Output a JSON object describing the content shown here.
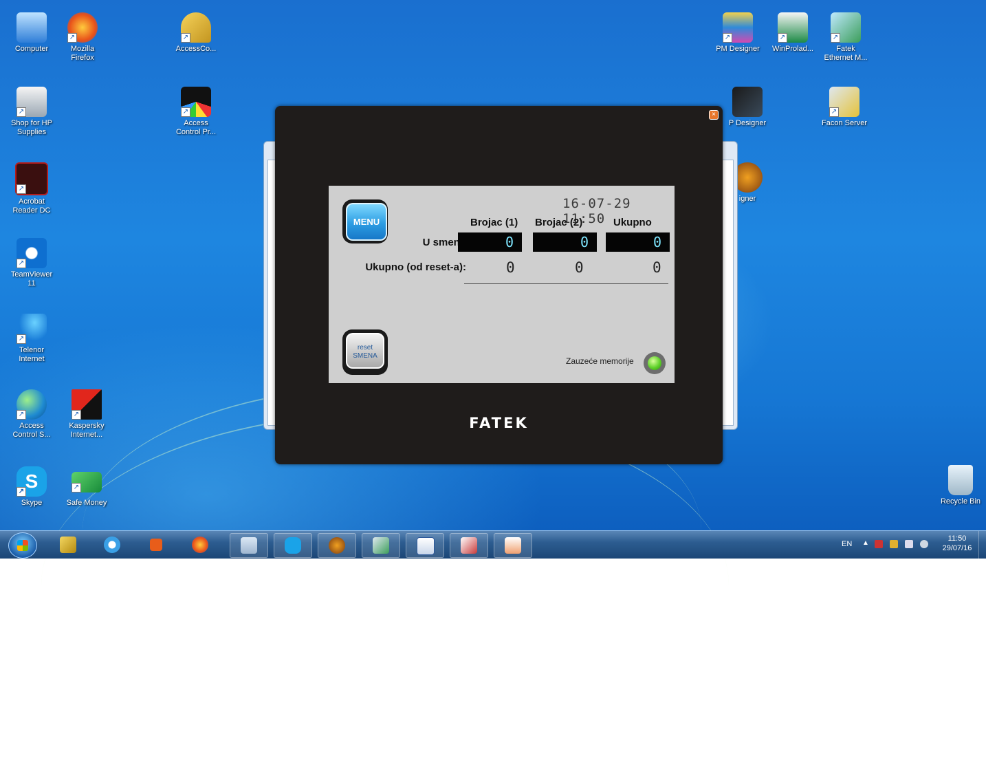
{
  "desktop_icons": [
    {
      "label": "Computer",
      "icon": "computer-icon"
    },
    {
      "label": "Mozilla\nFirefox",
      "icon": "firefox-icon"
    },
    {
      "label": "AccessCo...",
      "icon": "keys-icon"
    },
    {
      "label": "Shop for HP\nSupplies",
      "icon": "printer-icon"
    },
    {
      "label": "Access\nControl Pr...",
      "icon": "access-control-icon"
    },
    {
      "label": "Acrobat\nReader DC",
      "icon": "acrobat-icon"
    },
    {
      "label": "TeamViewer\n11",
      "icon": "teamviewer-icon"
    },
    {
      "label": "Telenor\nInternet",
      "icon": "telenor-icon"
    },
    {
      "label": "Access\nControl S...",
      "icon": "globe-icon"
    },
    {
      "label": "Kaspersky\nInternet...",
      "icon": "kaspersky-icon"
    },
    {
      "label": "Skype",
      "icon": "skype-icon"
    },
    {
      "label": "Safe Money",
      "icon": "safe-money-icon"
    },
    {
      "label": "PM Designer",
      "icon": "pm-designer-icon"
    },
    {
      "label": "WinProlad...",
      "icon": "winproladder-icon"
    },
    {
      "label": "Fatek\nEthernet M...",
      "icon": "fatek-ethernet-icon"
    },
    {
      "label": "P Designer",
      "icon": "p-designer-icon"
    },
    {
      "label": "Facon Server",
      "icon": "facon-server-icon"
    },
    {
      "label": "igner",
      "icon": "designer-icon"
    },
    {
      "label": "Recycle Bin",
      "icon": "recycle-bin-icon"
    }
  ],
  "hmi": {
    "datetime": "16-07-29  11:50",
    "menu_label": "MENU",
    "reset_label_line1": "reset",
    "reset_label_line2": "SMENA",
    "headers": [
      "Brojac (1)",
      "Brojac (2)",
      "Ukupno"
    ],
    "row1_label": "U smeni:",
    "row1_values": [
      "0",
      "0",
      "0"
    ],
    "row2_label": "Ukupno (od reset-a):",
    "row2_values": [
      "0",
      "0",
      "0"
    ],
    "memory_label": "Zauzeće memorije",
    "memory_status": "on",
    "brand": "FATEK"
  },
  "taskbar": {
    "apps": [
      "access-keys-icon",
      "internet-explorer-icon",
      "media-player-icon",
      "firefox-icon",
      "notepad-icon",
      "skype-icon",
      "wplsoft-icon",
      "network-icon",
      "word-icon",
      "access-icon",
      "presentation-icon"
    ],
    "language": "EN",
    "time": "11:50",
    "date": "29/07/16"
  },
  "colors": {
    "lcd_digit": "#7fe6ff",
    "led": "#5fd12a",
    "hmi_bezel": "#1f1c1b"
  }
}
